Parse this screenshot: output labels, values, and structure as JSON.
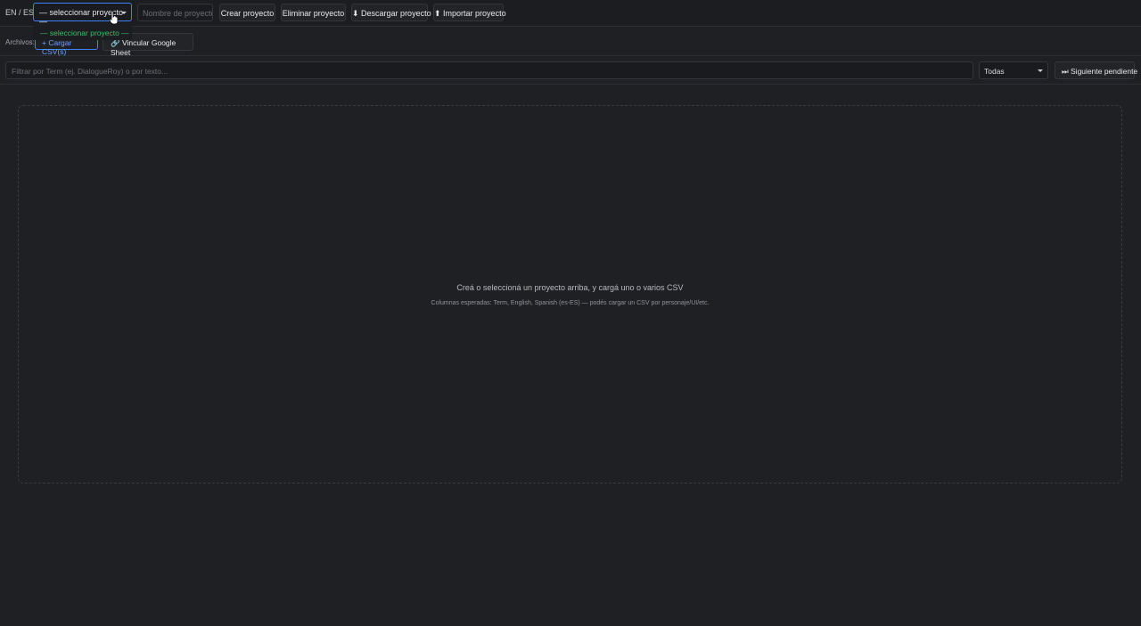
{
  "header": {
    "lang_toggle": "EN / ES",
    "project_select": {
      "value": "— seleccionar proyecto —"
    },
    "project_name_input": {
      "placeholder": "Nombre de proyecto n"
    },
    "buttons": {
      "create": "Crear proyecto",
      "delete": "Eliminar proyecto",
      "download": "⬇ Descargar proyecto",
      "import": "⬆ Importar proyecto"
    },
    "dropdown_option": "— seleccionar proyecto —"
  },
  "files": {
    "label": "Archivos:",
    "upload_csv": "+ Cargar CSV(s)",
    "link_sheet": "🔗 Vincular Google Sheet"
  },
  "filter": {
    "placeholder": "Filtrar por Term (ej. DialogueRoy) o por texto...",
    "status_select": "Todas",
    "next_pending": "⏭ Siguiente pendiente"
  },
  "empty_state": {
    "title": "Creá o seleccioná un proyecto arriba, y cargá uno o varios CSV",
    "subtitle": "Columnas esperadas: Term, English, Spanish (es-ES) — podés cargar un CSV por personaje/UI/etc."
  },
  "colors": {
    "accent": "#3b82f6",
    "selected_option": "#3fbf6a",
    "background": "#1f2023"
  }
}
